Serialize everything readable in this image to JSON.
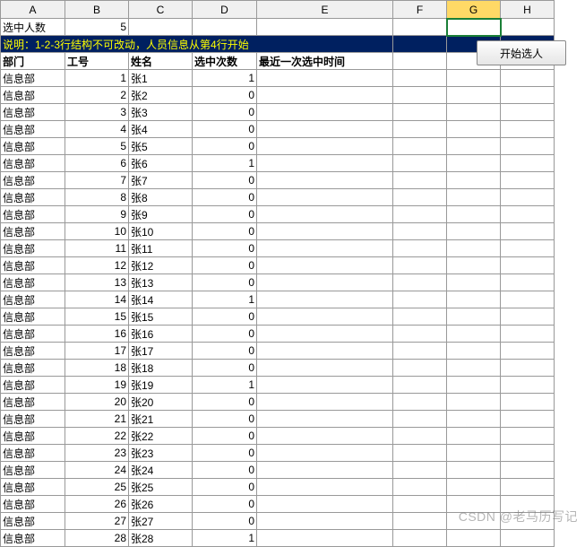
{
  "columns": {
    "headers": [
      "A",
      "B",
      "C",
      "D",
      "E",
      "F",
      "G",
      "H"
    ],
    "widths": [
      72,
      71,
      71,
      72,
      152,
      60,
      60,
      60
    ],
    "selected_index": 6
  },
  "row1": {
    "label": "选中人数",
    "value": 5
  },
  "row2": {
    "note": "说明：1-2-3行结构不可改动，人员信息从第4行开始"
  },
  "row3": {
    "dept": "部门",
    "id": "工号",
    "name": "姓名",
    "count": "选中次数",
    "last": "最近一次选中时间"
  },
  "data_rows": [
    {
      "dept": "信息部",
      "id": 1,
      "name": "张1",
      "count": 1,
      "last": ""
    },
    {
      "dept": "信息部",
      "id": 2,
      "name": "张2",
      "count": 0,
      "last": ""
    },
    {
      "dept": "信息部",
      "id": 3,
      "name": "张3",
      "count": 0,
      "last": ""
    },
    {
      "dept": "信息部",
      "id": 4,
      "name": "张4",
      "count": 0,
      "last": ""
    },
    {
      "dept": "信息部",
      "id": 5,
      "name": "张5",
      "count": 0,
      "last": ""
    },
    {
      "dept": "信息部",
      "id": 6,
      "name": "张6",
      "count": 1,
      "last": ""
    },
    {
      "dept": "信息部",
      "id": 7,
      "name": "张7",
      "count": 0,
      "last": ""
    },
    {
      "dept": "信息部",
      "id": 8,
      "name": "张8",
      "count": 0,
      "last": ""
    },
    {
      "dept": "信息部",
      "id": 9,
      "name": "张9",
      "count": 0,
      "last": ""
    },
    {
      "dept": "信息部",
      "id": 10,
      "name": "张10",
      "count": 0,
      "last": ""
    },
    {
      "dept": "信息部",
      "id": 11,
      "name": "张11",
      "count": 0,
      "last": ""
    },
    {
      "dept": "信息部",
      "id": 12,
      "name": "张12",
      "count": 0,
      "last": ""
    },
    {
      "dept": "信息部",
      "id": 13,
      "name": "张13",
      "count": 0,
      "last": ""
    },
    {
      "dept": "信息部",
      "id": 14,
      "name": "张14",
      "count": 1,
      "last": ""
    },
    {
      "dept": "信息部",
      "id": 15,
      "name": "张15",
      "count": 0,
      "last": ""
    },
    {
      "dept": "信息部",
      "id": 16,
      "name": "张16",
      "count": 0,
      "last": ""
    },
    {
      "dept": "信息部",
      "id": 17,
      "name": "张17",
      "count": 0,
      "last": ""
    },
    {
      "dept": "信息部",
      "id": 18,
      "name": "张18",
      "count": 0,
      "last": ""
    },
    {
      "dept": "信息部",
      "id": 19,
      "name": "张19",
      "count": 1,
      "last": ""
    },
    {
      "dept": "信息部",
      "id": 20,
      "name": "张20",
      "count": 0,
      "last": ""
    },
    {
      "dept": "信息部",
      "id": 21,
      "name": "张21",
      "count": 0,
      "last": ""
    },
    {
      "dept": "信息部",
      "id": 22,
      "name": "张22",
      "count": 0,
      "last": ""
    },
    {
      "dept": "信息部",
      "id": 23,
      "name": "张23",
      "count": 0,
      "last": ""
    },
    {
      "dept": "信息部",
      "id": 24,
      "name": "张24",
      "count": 0,
      "last": ""
    },
    {
      "dept": "信息部",
      "id": 25,
      "name": "张25",
      "count": 0,
      "last": ""
    },
    {
      "dept": "信息部",
      "id": 26,
      "name": "张26",
      "count": 0,
      "last": ""
    },
    {
      "dept": "信息部",
      "id": 27,
      "name": "张27",
      "count": 0,
      "last": ""
    },
    {
      "dept": "信息部",
      "id": 28,
      "name": "张28",
      "count": 1,
      "last": ""
    }
  ],
  "button": {
    "label": "开始选人"
  },
  "watermark": "CSDN @老马历写记"
}
